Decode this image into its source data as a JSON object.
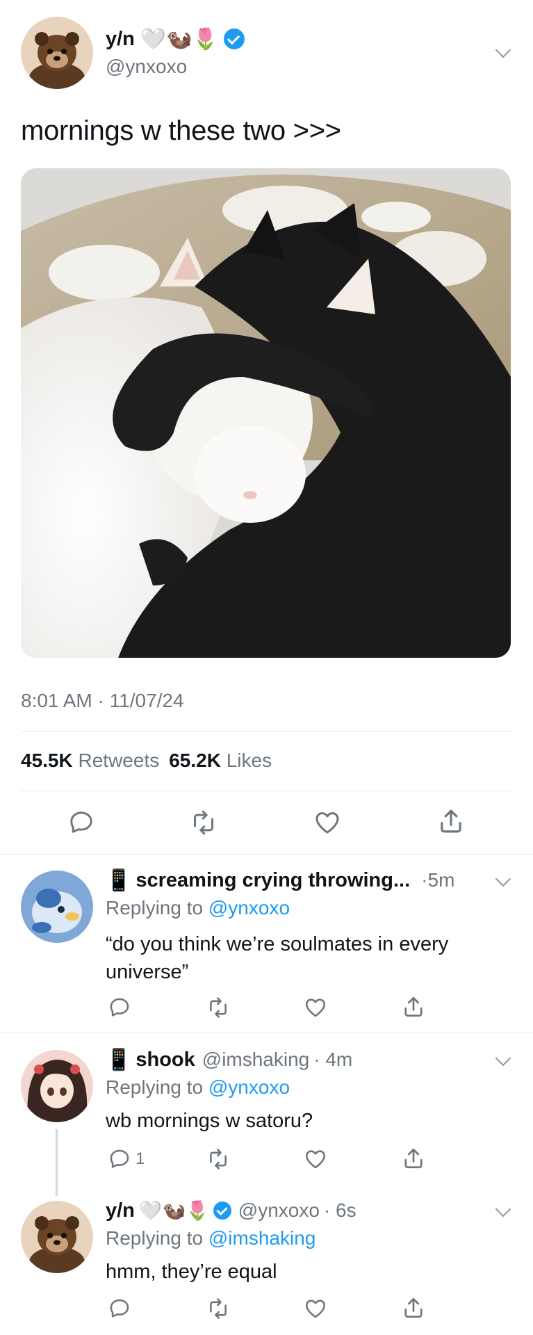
{
  "main_tweet": {
    "display_name": "y/n",
    "name_emojis": "🤍🦦🌷",
    "handle": "@ynxoxo",
    "text": "mornings w these two >>>",
    "photo_alt": "cats-sleeping-photo",
    "time": "8:01 AM",
    "date": "11/07/24",
    "retweets_count": "45.5K",
    "retweets_label": "Retweets",
    "likes_count": "65.2K",
    "likes_label": "Likes"
  },
  "replies": [
    {
      "emoji": "📱",
      "display_name": "screaming crying throwing...",
      "time": "·5m",
      "replying_prefix": "Replying to",
      "replying_to": "@ynxoxo",
      "text": "“do you think we’re soulmates in every universe”",
      "reply_count": ""
    },
    {
      "emoji": "📱",
      "display_name": "shook",
      "handle": "@imshaking",
      "time": "· 4m",
      "replying_prefix": "Replying to",
      "replying_to": "@ynxoxo",
      "text": "wb mornings w satoru?",
      "reply_count": "1"
    },
    {
      "display_name": "y/n",
      "name_emojis": "🤍🦦🌷",
      "handle": "@ynxoxo",
      "time": "· 6s",
      "replying_prefix": "Replying to",
      "replying_to": "@imshaking",
      "text": "hmm, they’re equal",
      "reply_count": ""
    }
  ],
  "colors": {
    "accent": "#1d9bf0",
    "text": "#0f1419",
    "secondary": "#6e767d",
    "divider": "#e1e8ed"
  },
  "icons": [
    "reply-icon",
    "retweet-icon",
    "like-icon",
    "share-icon",
    "chevron-down-icon",
    "verified-badge-icon"
  ]
}
